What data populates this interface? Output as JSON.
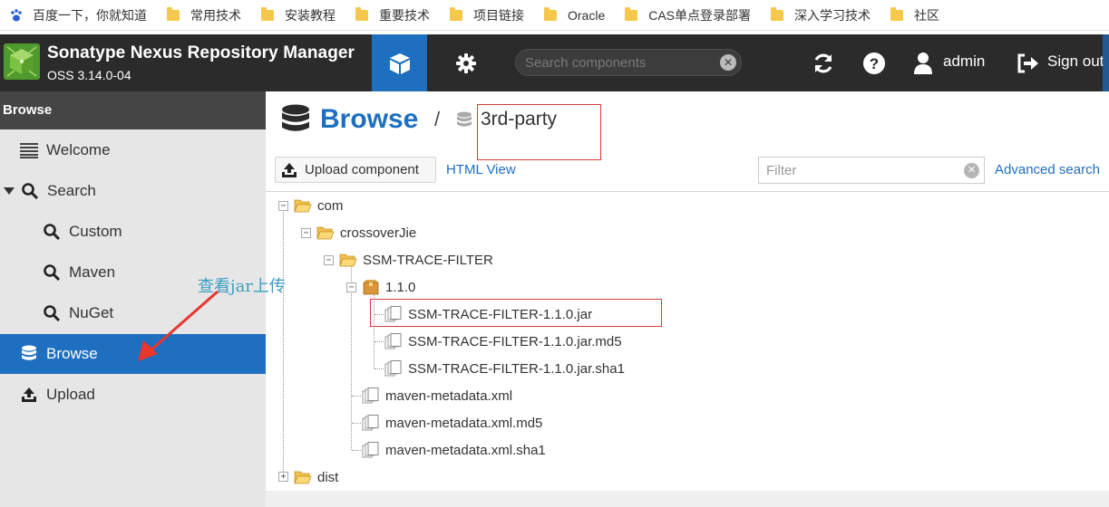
{
  "bookmarks": [
    {
      "label": "百度一下，你就知道",
      "icon": "baidu-paw-icon"
    },
    {
      "label": "常用技术",
      "icon": "folder-icon"
    },
    {
      "label": "安装教程",
      "icon": "folder-icon"
    },
    {
      "label": "重要技术",
      "icon": "folder-icon"
    },
    {
      "label": "项目链接",
      "icon": "folder-icon"
    },
    {
      "label": "Oracle",
      "icon": "folder-icon"
    },
    {
      "label": "CAS单点登录部署",
      "icon": "folder-icon"
    },
    {
      "label": "深入学习技术",
      "icon": "folder-icon"
    },
    {
      "label": "社区",
      "icon": "folder-icon"
    }
  ],
  "header": {
    "title": "Sonatype Nexus Repository Manager",
    "version": "OSS 3.14.0-04",
    "search_placeholder": "Search components",
    "user": "admin",
    "sign_out": "Sign out"
  },
  "sidebar": {
    "heading": "Browse",
    "items": [
      {
        "label": "Welcome",
        "icon": "list-icon"
      },
      {
        "label": "Search",
        "icon": "search-icon"
      },
      {
        "label": "Custom",
        "icon": "search-icon"
      },
      {
        "label": "Maven",
        "icon": "search-icon"
      },
      {
        "label": "NuGet",
        "icon": "search-icon"
      },
      {
        "label": "Browse",
        "icon": "database-icon"
      },
      {
        "label": "Upload",
        "icon": "upload-icon"
      }
    ]
  },
  "annotation": {
    "text": "查看jar上传",
    "color": "#3a9ec2"
  },
  "main": {
    "title": "Browse",
    "separator": "/",
    "repository": "3rd-party",
    "upload_button": "Upload component",
    "html_view": "HTML View",
    "filter_placeholder": "Filter",
    "advanced_search": "Advanced search"
  },
  "tree": [
    {
      "label": "com",
      "icon": "folder-open-icon"
    },
    {
      "label": "crossoverJie",
      "icon": "folder-open-icon"
    },
    {
      "label": "SSM-TRACE-FILTER",
      "icon": "folder-open-icon"
    },
    {
      "label": "1.1.0",
      "icon": "package-icon"
    },
    {
      "label": "SSM-TRACE-FILTER-1.1.0.jar",
      "icon": "file-icon"
    },
    {
      "label": "SSM-TRACE-FILTER-1.1.0.jar.md5",
      "icon": "file-icon"
    },
    {
      "label": "SSM-TRACE-FILTER-1.1.0.jar.sha1",
      "icon": "file-icon"
    },
    {
      "label": "maven-metadata.xml",
      "icon": "file-icon"
    },
    {
      "label": "maven-metadata.xml.md5",
      "icon": "file-icon"
    },
    {
      "label": "maven-metadata.xml.sha1",
      "icon": "file-icon"
    },
    {
      "label": "dist",
      "icon": "folder-open-icon"
    }
  ],
  "colors": {
    "accent": "#1e6fbf",
    "header_bg": "#2b2b2b",
    "sidebar_bg": "#e6e6e6",
    "highlight_red": "#d9393b"
  }
}
